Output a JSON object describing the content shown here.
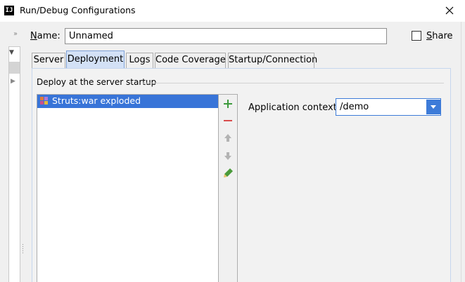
{
  "window": {
    "title": "Run/Debug Configurations",
    "app_icon_text": "IJ"
  },
  "sidebar": {
    "expand_icon_glyph": "››",
    "tree_toggle_glyph": "▼",
    "tree_item_glyph": "▶"
  },
  "config": {
    "name_label_mnemonic": "N",
    "name_label_rest": "ame:",
    "name_value": "Unnamed",
    "share_checked": false,
    "share_label_mnemonic": "S",
    "share_label_rest": "hare"
  },
  "tabs": [
    {
      "label": "Server",
      "active": false
    },
    {
      "label": "Deployment",
      "active": true
    },
    {
      "label": "Logs",
      "active": false
    },
    {
      "label": "Code Coverage",
      "active": false
    },
    {
      "label": "Startup/Connection",
      "active": false
    }
  ],
  "deployment": {
    "group_title": "Deploy at the server startup",
    "artifacts": [
      {
        "label": "Struts:war exploded",
        "selected": true,
        "icon": "artifact-icon"
      }
    ],
    "toolbar": [
      {
        "name": "add-icon",
        "color": "#3c9a3c"
      },
      {
        "name": "remove-icon",
        "color": "#d94c4c"
      },
      {
        "name": "move-up-icon",
        "color": "#b3b3b3"
      },
      {
        "name": "move-down-icon",
        "color": "#b3b3b3"
      },
      {
        "name": "edit-icon",
        "color": "#4a9a3a"
      }
    ],
    "app_context_label": "Application context:",
    "app_context_value": "/demo"
  },
  "colors": {
    "selection": "#3874d8",
    "active_tab": "#d3e1f6",
    "focus_border": "#3d7bd8"
  }
}
